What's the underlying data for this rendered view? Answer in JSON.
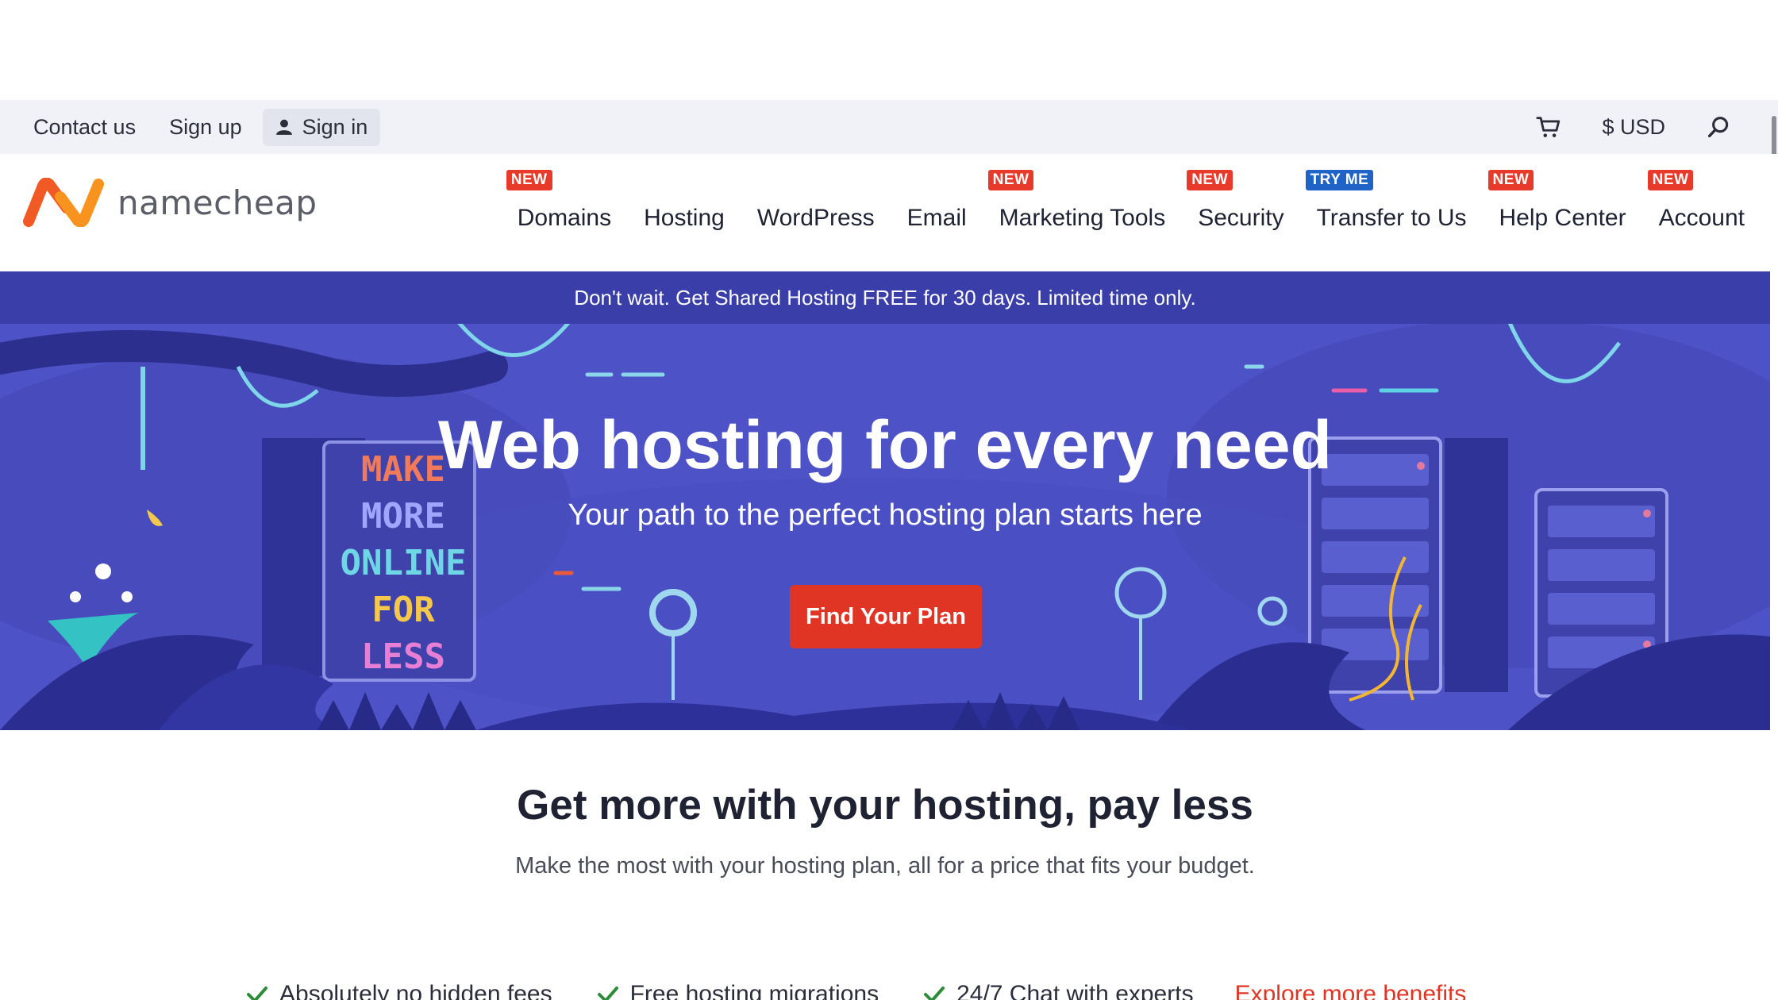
{
  "utility_bar": {
    "contact_label": "Contact us",
    "signup_label": "Sign up",
    "signin_label": "Sign in",
    "currency_label": "$ USD"
  },
  "brand": {
    "logo_text": "namecheap",
    "logo_colors": [
      "#f15a24",
      "#f7931e"
    ]
  },
  "nav": {
    "items": [
      {
        "label": "Domains",
        "badge": "NEW"
      },
      {
        "label": "Hosting",
        "badge": ""
      },
      {
        "label": "WordPress",
        "badge": ""
      },
      {
        "label": "Email",
        "badge": ""
      },
      {
        "label": "Marketing Tools",
        "badge": "NEW"
      },
      {
        "label": "Security",
        "badge": "NEW"
      },
      {
        "label": "Transfer to Us",
        "badge": "TRY ME"
      },
      {
        "label": "Help Center",
        "badge": "NEW"
      },
      {
        "label": "Account",
        "badge": "NEW"
      }
    ]
  },
  "hero": {
    "promo_text": "Don't wait. Get Shared Hosting FREE for 30 days. Limited time only.",
    "title": "Web hosting for every need",
    "subtitle": "Your path to the perfect hosting plan starts here",
    "cta_label": "Find Your Plan",
    "sign_text": [
      "MAKE",
      "MORE",
      "ONLINE",
      "FOR",
      "LESS"
    ],
    "colors": {
      "background": "#4d52c7",
      "promo": "#3a3ea8",
      "cta": "#e03524"
    }
  },
  "benefits_section": {
    "title": "Get more with your hosting, pay less",
    "subtitle": "Make the most with your hosting plan, all for a price that fits your budget.",
    "items": [
      "Absolutely no hidden fees",
      "Free hosting migrations",
      "24/7 Chat with experts"
    ],
    "explore_label": "Explore more benefits",
    "check_color": "#2e8b3a"
  }
}
